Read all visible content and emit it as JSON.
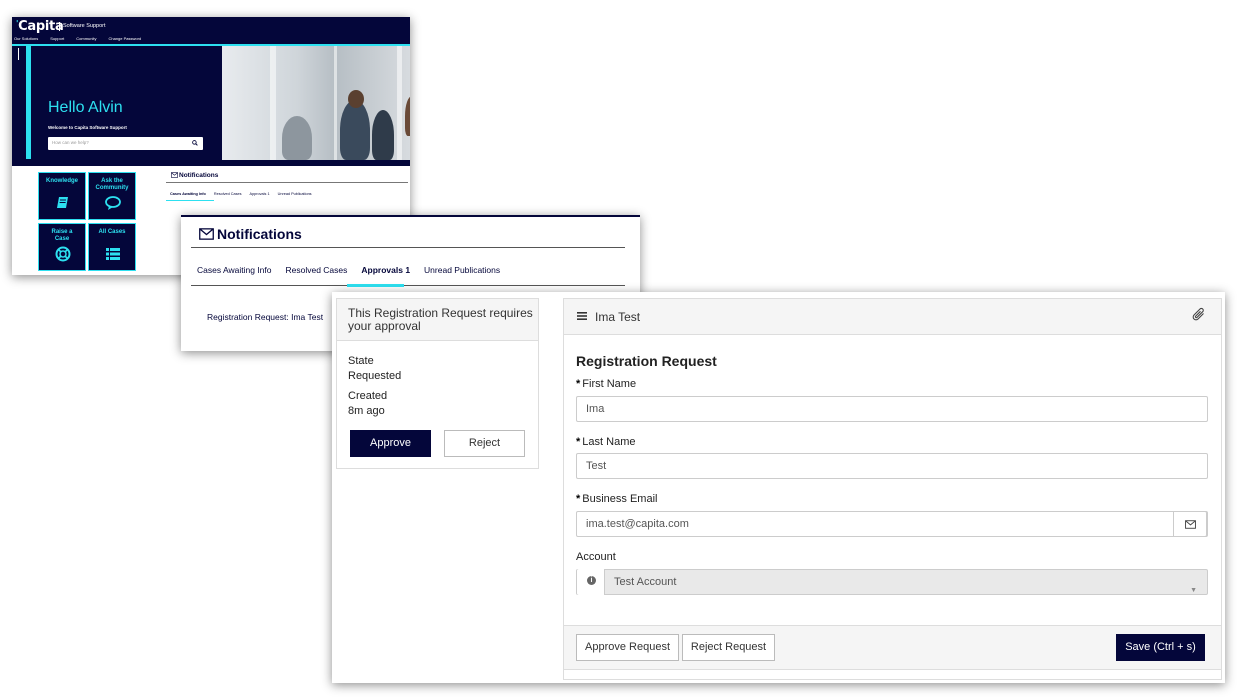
{
  "portal": {
    "logo": "Capita",
    "subtitle": "Software Support",
    "nav": [
      "Our Solutions",
      "Support",
      "Community",
      "Change Password"
    ],
    "greeting": "Hello Alvin",
    "welcome": "Welcome to Capita Software Support",
    "search_placeholder": "How can we help?",
    "tiles": [
      {
        "label": "Knowledge",
        "icon": "book-icon"
      },
      {
        "label": "Ask the Community",
        "icon": "chat-icon"
      },
      {
        "label": "Raise a Case",
        "icon": "lifebuoy-icon"
      },
      {
        "label": "All Cases",
        "icon": "list-icon"
      }
    ],
    "notifications_title": "Notifications",
    "tabs": [
      "Cases Awaiting Info",
      "Resolved Cases",
      "Approvals 1",
      "Unread Publications"
    ],
    "colors": {
      "navy": "#04063a",
      "cyan": "#2de0f0"
    }
  },
  "notifications": {
    "title": "Notifications",
    "tabs": [
      {
        "label": "Cases Awaiting Info",
        "active": false
      },
      {
        "label": "Resolved Cases",
        "active": false
      },
      {
        "label": "Approvals 1",
        "active": true
      },
      {
        "label": "Unread Publications",
        "active": false
      }
    ],
    "item": "Registration Request: Ima Test"
  },
  "approval": {
    "card_title": "This Registration Request requires your approval",
    "state_label": "State",
    "state_value": "Requested",
    "created_label": "Created",
    "created_value": "8m ago",
    "approve": "Approve",
    "reject": "Reject"
  },
  "form": {
    "record_title": "Ima Test",
    "heading": "Registration Request",
    "required_marker": "*",
    "first_name_label": "First Name",
    "first_name": "Ima",
    "last_name_label": "Last Name",
    "last_name": "Test",
    "email_label": "Business Email",
    "email": "ima.test@capita.com",
    "account_label": "Account",
    "account": "Test Account",
    "approve_request": "Approve Request",
    "reject_request": "Reject Request",
    "save": "Save (Ctrl + s)"
  }
}
